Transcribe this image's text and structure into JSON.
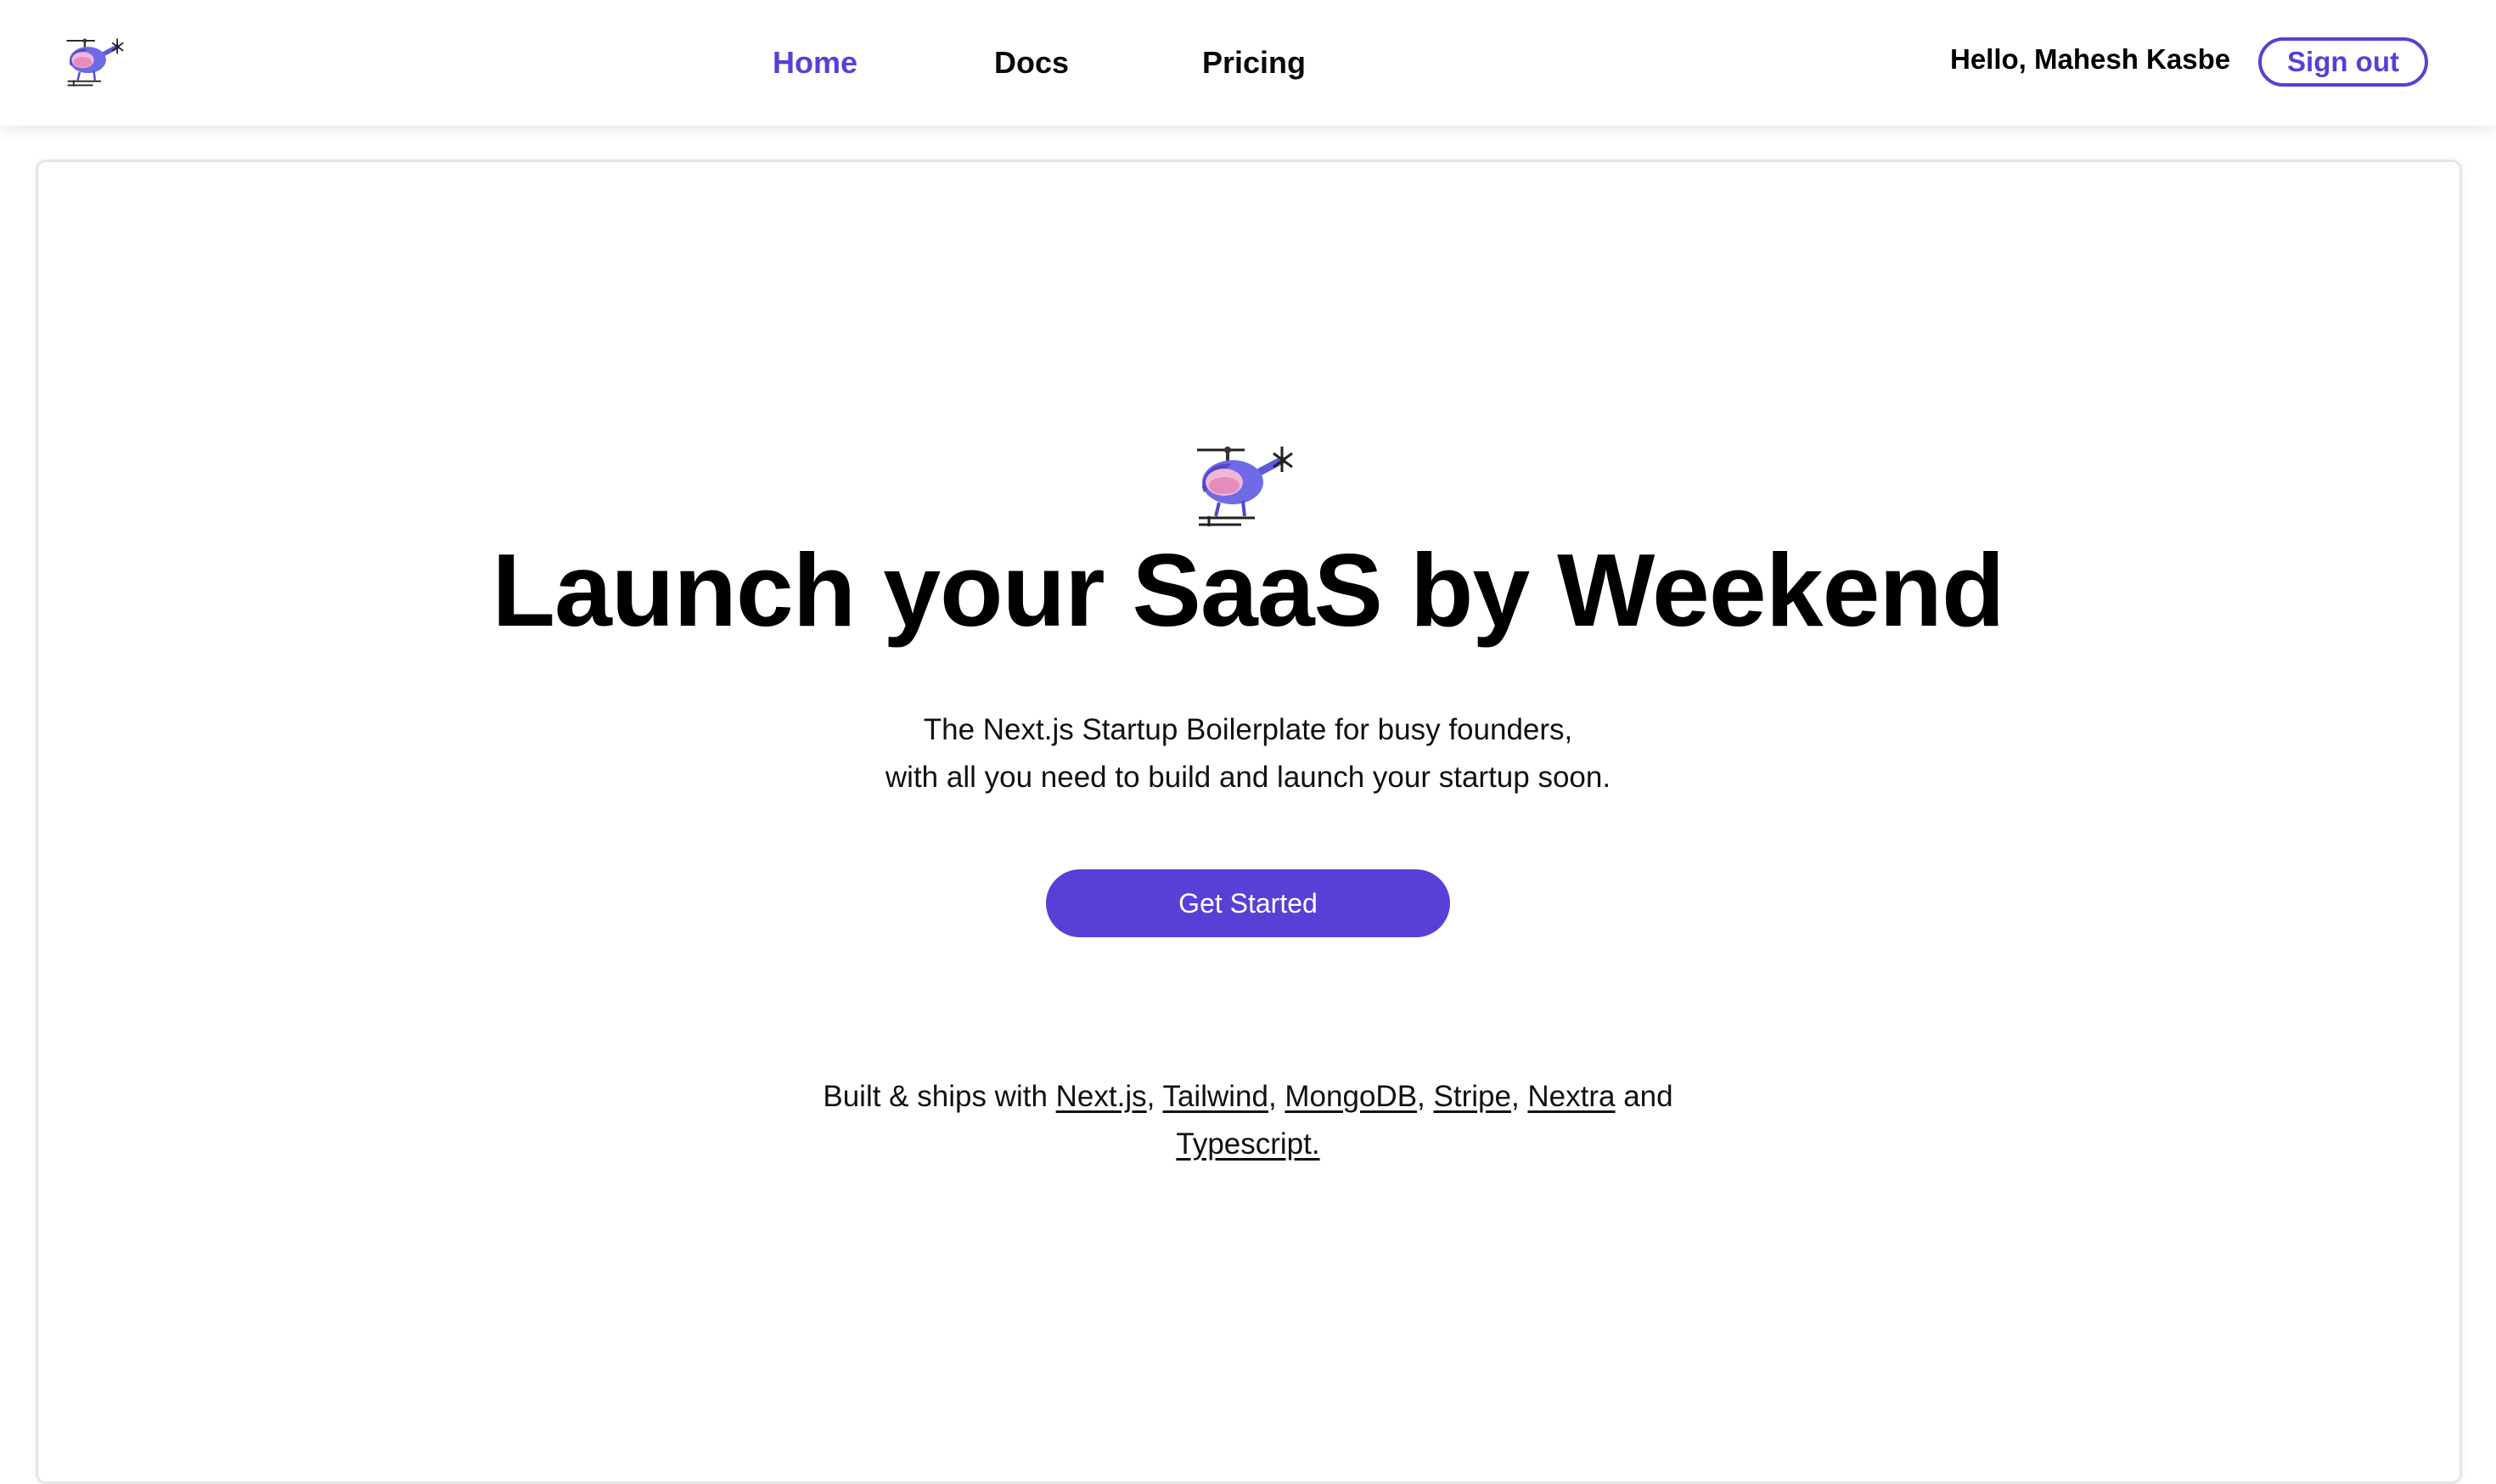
{
  "header": {
    "logo_icon": "helicopter-icon",
    "nav": [
      {
        "label": "Home",
        "active": true
      },
      {
        "label": "Docs",
        "active": false
      },
      {
        "label": "Pricing",
        "active": false
      }
    ],
    "greeting": "Hello, Mahesh Kasbe",
    "signout_label": "Sign out"
  },
  "hero": {
    "icon": "helicopter-icon",
    "title": "Launch your SaaS by Weekend",
    "subtitle_line1": "The Next.js Startup Boilerplate for busy founders,",
    "subtitle_line2": "with all you need to build and launch your startup soon.",
    "cta_label": "Get Started"
  },
  "built_with": {
    "prefix": "Built & ships with",
    "links": [
      "Next.js",
      "Tailwind",
      "MongoDB",
      "Stripe",
      "Nextra"
    ],
    "conjunction": "and",
    "last_link": "Typescript."
  },
  "colors": {
    "accent": "#5a3fd6",
    "text": "#0a0a0a",
    "background": "#ffffff"
  }
}
